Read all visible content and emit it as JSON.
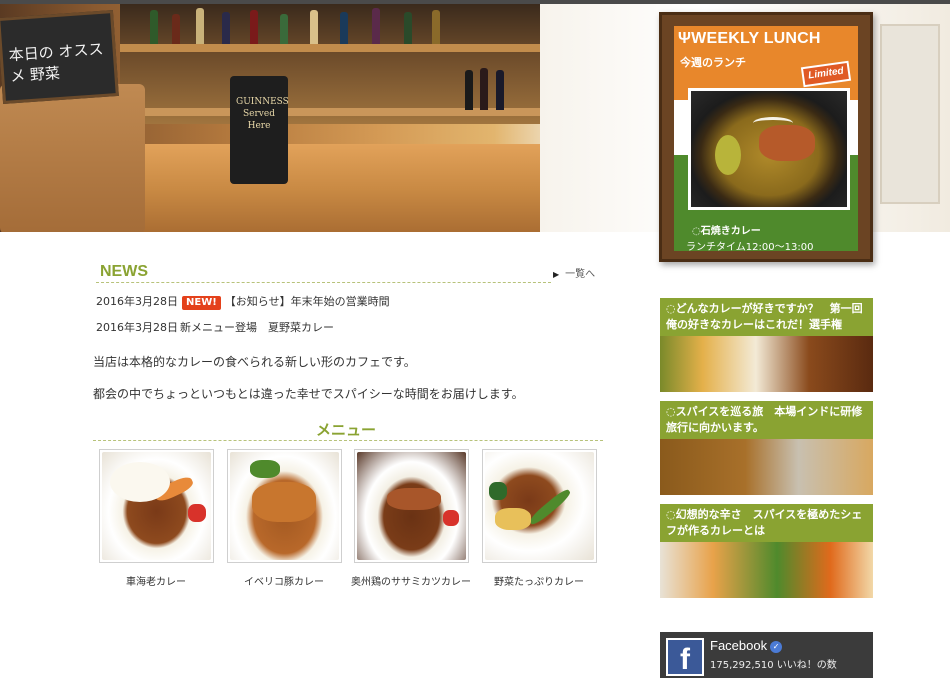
{
  "hero": {
    "blackboard_text": "本日の オススメ 野菜",
    "guinness_text": "GUINNESS Served Here"
  },
  "weekly_lunch": {
    "title": "WEEKLY LUNCH",
    "subtitle": "今週のランチ",
    "badge": "Limited",
    "dish": "石焼きカレー",
    "time": "ランチタイム12:00〜13:00"
  },
  "news": {
    "heading": "NEWS",
    "more_label": "一覧へ",
    "items": [
      {
        "date": "2016年3月28日",
        "badge": "NEW!",
        "title": "【お知らせ】年末年始の営業時間"
      },
      {
        "date": "2016年3月28日",
        "badge": "",
        "title": "新メニュー登場　夏野菜カレー"
      }
    ]
  },
  "intro": {
    "line1": "当店は本格的なカレーの食べられる新しい形のカフェです。",
    "line2": "都会の中でちょっといつもとは違った幸せでスパイシーな時間をお届けします。"
  },
  "menu": {
    "heading": "メニュー",
    "items": [
      {
        "name": "車海老カレー"
      },
      {
        "name": "イベリコ豚カレー"
      },
      {
        "name": "奥州鶏のササミカツカレー"
      },
      {
        "name": "野菜たっぷりカレー"
      }
    ]
  },
  "side_banners": [
    {
      "label": "どんなカレーが好きですか？　第一回　俺の好きなカレーはこれだ！選手権"
    },
    {
      "label": "スパイスを巡る旅　本場インドに研修旅行に向かいます。"
    },
    {
      "label": "幻想的な辛さ　スパイスを極めたシェフが作るカレーとは"
    }
  ],
  "facebook": {
    "title": "Facebook",
    "likes": "175,292,510 いいね！の数"
  },
  "colors": {
    "accent_green": "#8aa332",
    "new_badge": "#e4411b",
    "lunch_orange": "#e8872b",
    "lunch_green": "#4f8a2c"
  }
}
